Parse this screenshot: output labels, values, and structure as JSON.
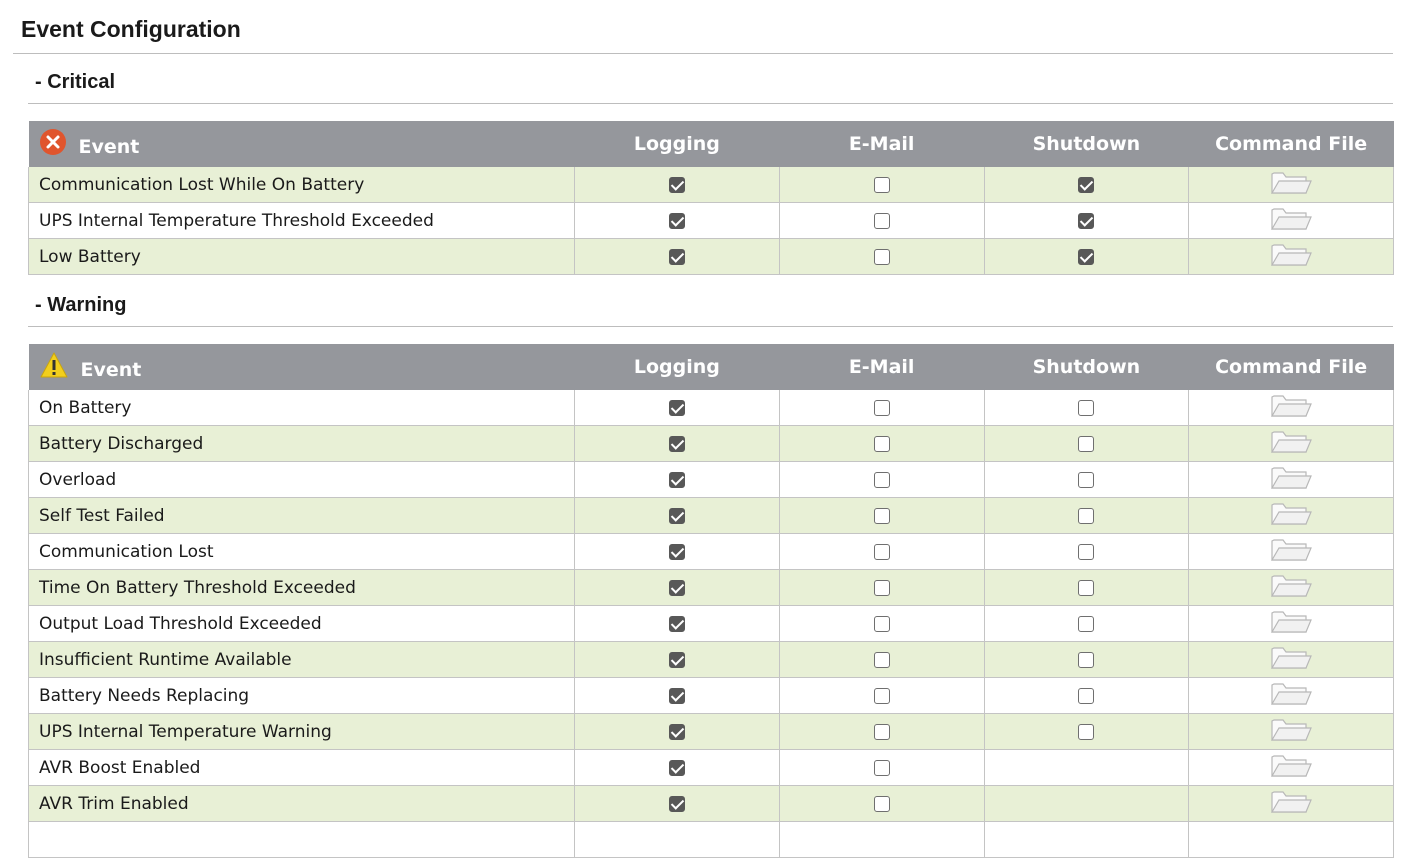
{
  "page": {
    "title": "Event Configuration"
  },
  "headers": {
    "event": "Event",
    "logging": "Logging",
    "email": "E-Mail",
    "shutdown": "Shutdown",
    "command_file": "Command File"
  },
  "icons": {
    "critical": "critical-x-icon",
    "warning": "warning-triangle-icon",
    "command_file": "folder-icon",
    "critical_color": "#e0552d",
    "warning_color": "#f2cf1d",
    "header_bg": "#95979c",
    "row_alt_bg": "#e8f0d6"
  },
  "sections": {
    "critical": {
      "title": "- Critical",
      "rows": [
        {
          "name": "Communication Lost While On Battery",
          "logging": true,
          "email": false,
          "shutdown": true
        },
        {
          "name": "UPS Internal Temperature Threshold Exceeded",
          "logging": true,
          "email": false,
          "shutdown": true
        },
        {
          "name": "Low Battery",
          "logging": true,
          "email": false,
          "shutdown": true
        }
      ]
    },
    "warning": {
      "title": "- Warning",
      "rows": [
        {
          "name": "On Battery",
          "logging": true,
          "email": false,
          "shutdown": false
        },
        {
          "name": "Battery Discharged",
          "logging": true,
          "email": false,
          "shutdown": false
        },
        {
          "name": "Overload",
          "logging": true,
          "email": false,
          "shutdown": false
        },
        {
          "name": "Self Test Failed",
          "logging": true,
          "email": false,
          "shutdown": false
        },
        {
          "name": "Communication Lost",
          "logging": true,
          "email": false,
          "shutdown": false
        },
        {
          "name": "Time On Battery Threshold Exceeded",
          "logging": true,
          "email": false,
          "shutdown": false
        },
        {
          "name": "Output Load Threshold Exceeded",
          "logging": true,
          "email": false,
          "shutdown": false
        },
        {
          "name": "Insufficient Runtime Available",
          "logging": true,
          "email": false,
          "shutdown": false
        },
        {
          "name": "Battery Needs Replacing",
          "logging": true,
          "email": false,
          "shutdown": false
        },
        {
          "name": "UPS Internal Temperature Warning",
          "logging": true,
          "email": false,
          "shutdown": false
        },
        {
          "name": "AVR Boost Enabled",
          "logging": true,
          "email": false,
          "shutdown": null
        },
        {
          "name": "AVR Trim Enabled",
          "logging": true,
          "email": false,
          "shutdown": null
        },
        {
          "name": "",
          "logging": null,
          "email": null,
          "shutdown": null
        }
      ]
    }
  }
}
